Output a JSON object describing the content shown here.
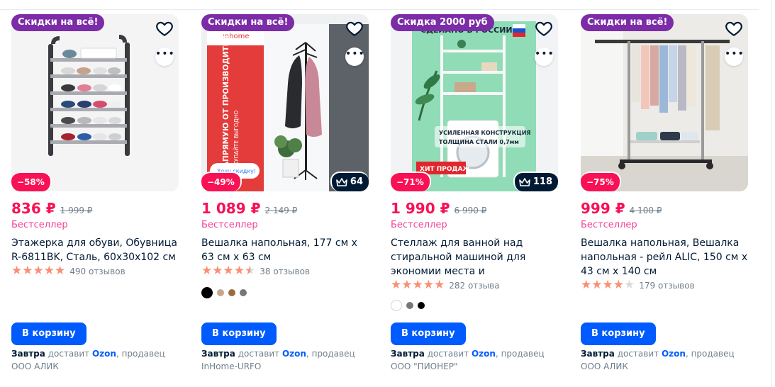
{
  "products": [
    {
      "promo": "Скидки на всё!",
      "discount": "−58%",
      "price": "836 ₽",
      "old_price": "1 999 ₽",
      "bestseller": "Бестселлер",
      "title": "Этажерка для обуви, Обувница R-6811BK, Сталь, 60х30х102 см",
      "reviews": "490 отзывов",
      "stars": 5,
      "button": "В корзину",
      "delivery_day": "Завтра",
      "delivery_text": "доставит",
      "delivery_brand": "Ozon",
      "seller_text": ", продавец",
      "seller": "ООО АЛИК"
    },
    {
      "promo": "Скидки на всё!",
      "discount": "−49%",
      "badge_count": "64",
      "price": "1 089 ₽",
      "old_price": "2 149 ₽",
      "bestseller": "Бестселлер",
      "title": "Вешалка напольная, 177 см х 63 см х 63 см",
      "reviews": "38 отзывов",
      "stars": 4.5,
      "button": "В корзину",
      "delivery_day": "Завтра",
      "delivery_text": "доставит",
      "delivery_brand": "Ozon",
      "seller_text": ", продавец",
      "seller": "InHome-URFO",
      "img_text_1": "НАПРЯМУЮ ОТ ПРОИЗВОДИТЕЛЯ",
      "img_text_2": "ПОКУПАЙТЕ ВЫГОДНО",
      "img_text_3": "Хочу скидку!",
      "img_text_4": "inhome"
    },
    {
      "promo": "Скидка 2000 руб",
      "discount": "−71%",
      "badge_count": "118",
      "price": "1 990 ₽",
      "old_price": "6 990 ₽",
      "bestseller": "Бестселлер",
      "title": "Стеллаж для ванной над стиральной машиной для экономии места и компактног...",
      "reviews": "282 отзыва",
      "stars": 5,
      "button": "В корзину",
      "delivery_day": "Завтра",
      "delivery_text": "доставит",
      "delivery_brand": "Ozon",
      "seller_text": ", продавец",
      "seller": "ООО \"ПИОНЕР\"",
      "img_text_1": "СДЕЛАНО В РОССИИ",
      "img_text_2": "УСИЛЕННАЯ КОНСТРУКЦИЯ",
      "img_text_3": "ТОЛЩИНА СТАЛИ 0,7мм",
      "img_text_4": "ХИТ ПРОДАЖ"
    },
    {
      "promo": "Скидки на всё!",
      "discount": "−75%",
      "price": "999 ₽",
      "old_price": "4 100 ₽",
      "bestseller": "Бестселлер",
      "title": "Вешалка напольная, Вешалка напольная - рейл ALIC, 150 см х 43 см х 140 см",
      "reviews": "179 отзывов",
      "stars": 4,
      "button": "В корзину",
      "delivery_day": "Завтра",
      "delivery_text": "доставит",
      "delivery_brand": "Ozon",
      "seller_text": ", продавец",
      "seller": "ООО АЛИК"
    }
  ],
  "icons": {
    "favorite": "heart-icon",
    "more": "more-icon",
    "crown": "crown-icon",
    "star": "star-icon"
  },
  "colors": {
    "promo": "#7b2ca6",
    "discount": "#f91155",
    "button": "#005bff",
    "star": "#f98f73"
  },
  "more_glyph": "•••"
}
